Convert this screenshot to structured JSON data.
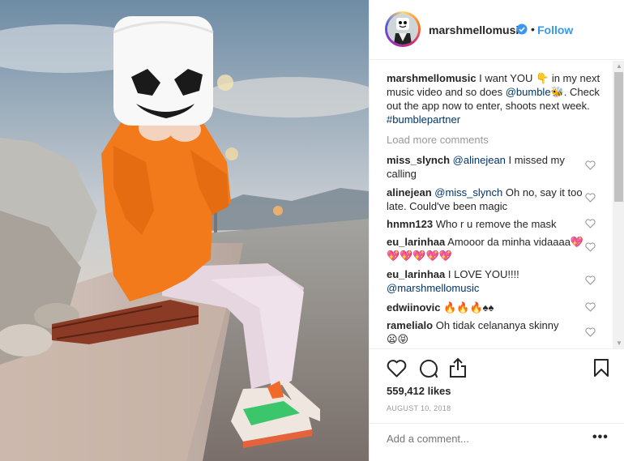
{
  "photo": {
    "alt": "Marshmello in orange hoodie sitting on bench"
  },
  "header": {
    "username": "marshmellomusic",
    "separator": "•",
    "follow_label": "Follow"
  },
  "caption": {
    "username": "marshmellomusic",
    "text_before_mention": "I want YOU 👇 in my next music video and so does",
    "mention": "@bumble",
    "text_after_mention": "🐝. Check out the app now to enter, shoots next week.",
    "hashtag": "#bumblepartner"
  },
  "load_more_label": "Load more comments",
  "comments": [
    {
      "user": "miss_slynch",
      "mention": "@alinejean",
      "text": "I missed my calling"
    },
    {
      "user": "alinejean",
      "mention": "@miss_slynch",
      "text": "Oh no, say it too late. Could've been magic"
    },
    {
      "user": "hnmn123",
      "mention": "",
      "text": "Who r u remove the mask"
    },
    {
      "user": "eu_larinhaa",
      "mention": "",
      "text": "Amooor da minha vidaaaa💖💖💖💖💖💖"
    },
    {
      "user": "eu_larinhaa",
      "mention": "",
      "text": "I LOVE YOU!!!!",
      "mention_after": "@marshmellomusic"
    },
    {
      "user": "edwiinovic",
      "mention": "",
      "text": "🔥🔥🔥♠♠"
    },
    {
      "user": "ramelialo",
      "mention": "",
      "text": "Oh tidak celananya skinny",
      "text2": "😦😝"
    }
  ],
  "likes": "559,412 likes",
  "date": "AUGUST 10, 2018",
  "add_comment_placeholder": "Add a comment...",
  "more_label": "•••",
  "icons": {
    "like": "heart-icon",
    "comment": "comment-icon",
    "share": "share-icon",
    "save": "bookmark-icon",
    "verified": "verified-badge-icon"
  },
  "colors": {
    "follow": "#3897f0",
    "link": "#003569",
    "muted": "#999999",
    "hoodie": "#f27a1a"
  }
}
